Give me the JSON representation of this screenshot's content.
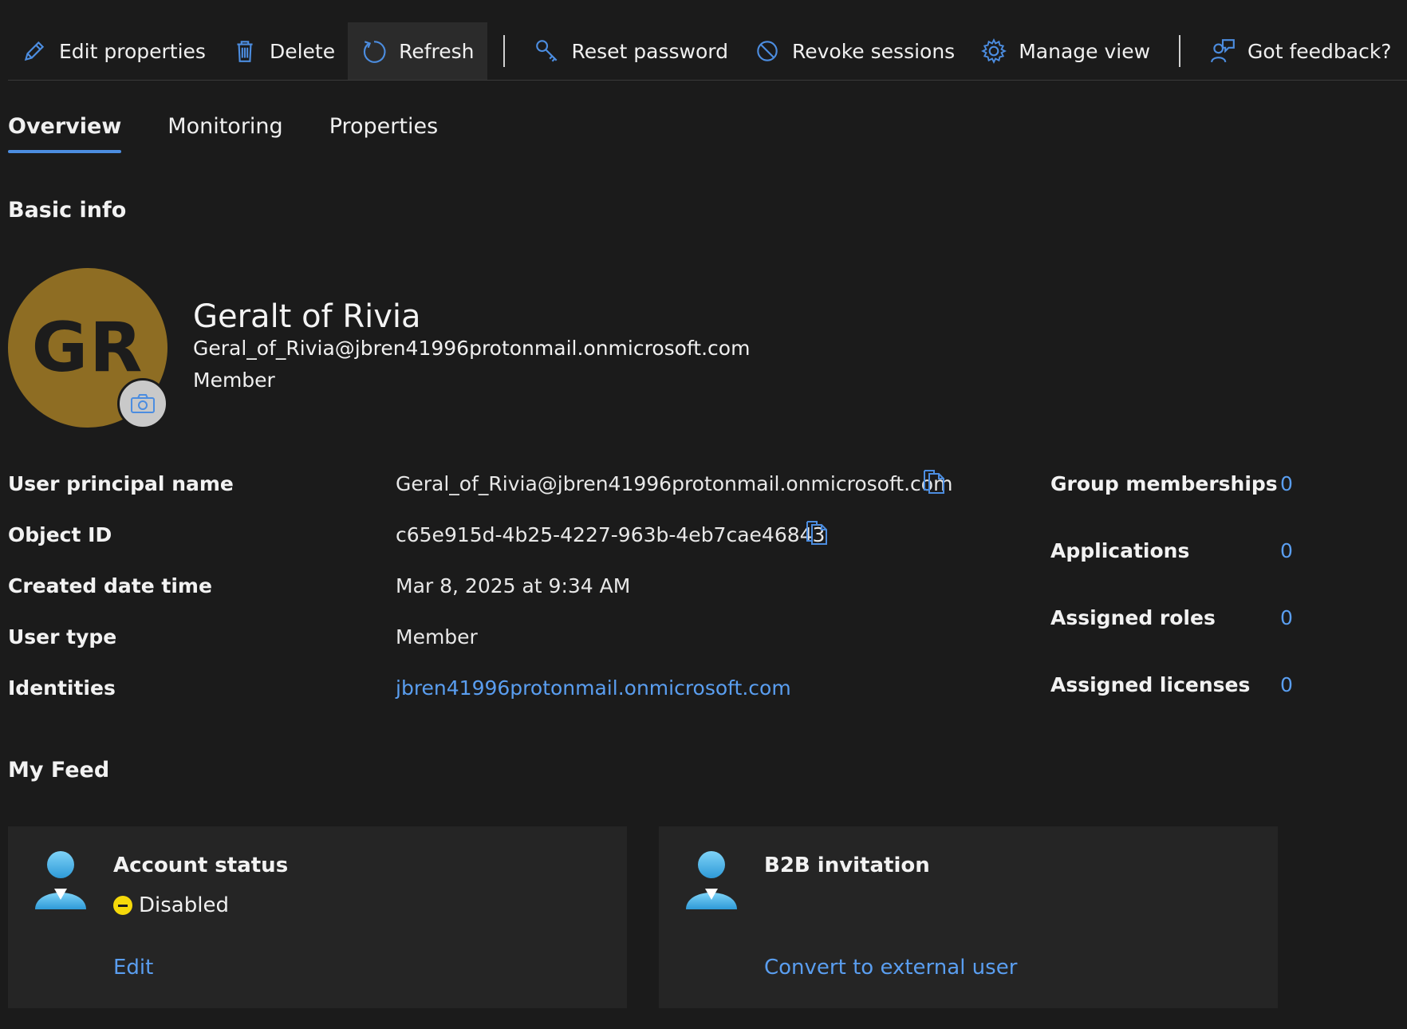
{
  "toolbar": {
    "items": [
      {
        "label": "Edit properties",
        "icon": "pencil-icon"
      },
      {
        "label": "Delete",
        "icon": "trash-icon"
      },
      {
        "label": "Refresh",
        "icon": "refresh-icon"
      },
      {
        "label": "Reset password",
        "icon": "key-icon"
      },
      {
        "label": "Revoke sessions",
        "icon": "block-icon"
      },
      {
        "label": "Manage view",
        "icon": "gear-icon"
      },
      {
        "label": "Got feedback?",
        "icon": "feedback-icon"
      }
    ]
  },
  "tabs": [
    {
      "label": "Overview",
      "active": true
    },
    {
      "label": "Monitoring",
      "active": false
    },
    {
      "label": "Properties",
      "active": false
    }
  ],
  "basic_info": {
    "title": "Basic info",
    "initials": "GR",
    "display_name": "Geralt of Rivia",
    "email": "Geral_of_Rivia@jbren41996protonmail.onmicrosoft.com",
    "role": "Member"
  },
  "properties": [
    {
      "label": "User principal name",
      "value": "Geral_of_Rivia@jbren41996protonmail.onmicrosoft.com"
    },
    {
      "label": "Object ID",
      "value": "c65e915d-4b25-4227-963b-4eb7cae46843"
    },
    {
      "label": "Created date time",
      "value": "Mar 8, 2025 at 9:34 AM"
    },
    {
      "label": "User type",
      "value": "Member"
    },
    {
      "label": "Identities",
      "value": "jbren41996protonmail.onmicrosoft.com"
    }
  ],
  "stats": [
    {
      "label": "Group memberships",
      "value": "0"
    },
    {
      "label": "Applications",
      "value": "0"
    },
    {
      "label": "Assigned roles",
      "value": "0"
    },
    {
      "label": "Assigned licenses",
      "value": "0"
    }
  ],
  "feed": {
    "title": "My Feed",
    "cards": [
      {
        "title": "Account status",
        "status": "Disabled",
        "link": "Edit"
      },
      {
        "title": "B2B invitation",
        "link": "Convert to external user"
      }
    ]
  },
  "colors": {
    "background": "#1b1b1b",
    "accent": "#4c8de0",
    "link": "#5a9ef0",
    "avatar": "#8e6d23",
    "status_disabled": "#f5d90a"
  }
}
